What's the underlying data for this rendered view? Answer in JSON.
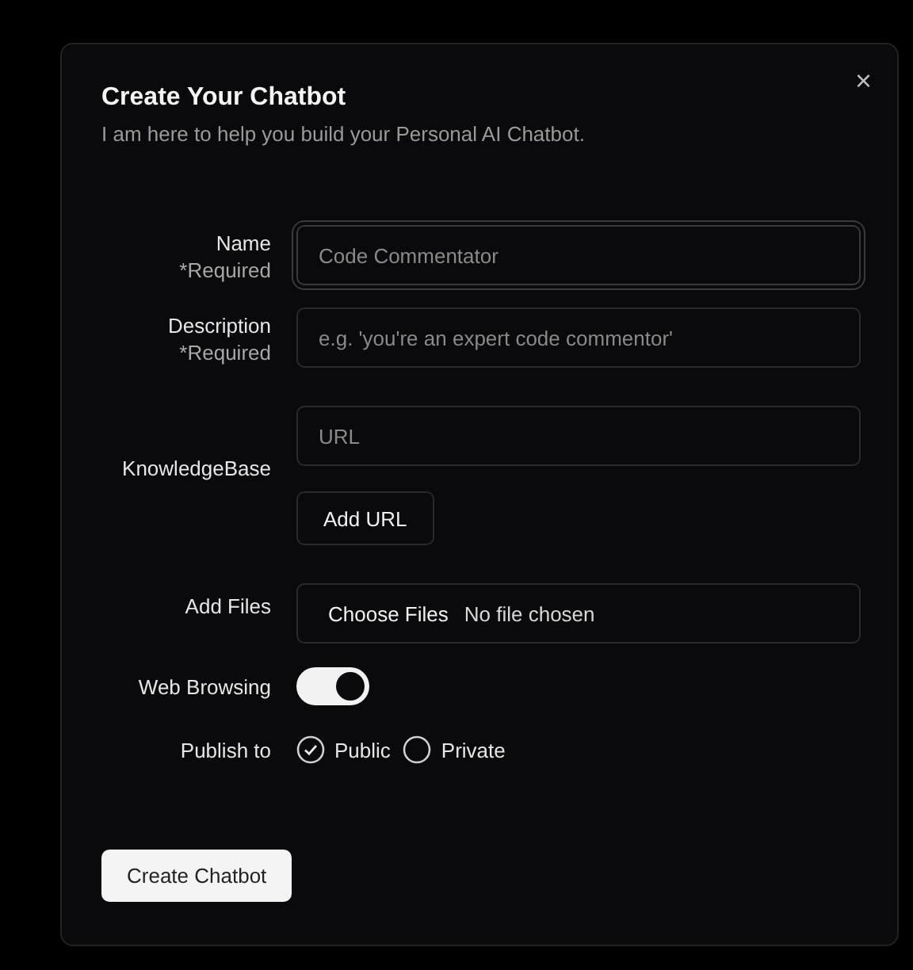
{
  "dialog": {
    "title": "Create Your Chatbot",
    "subtitle": "I am here to help you build your Personal AI Chatbot.",
    "close": "×"
  },
  "name": {
    "label": "Name",
    "required": "*Required",
    "placeholder": "Code Commentator",
    "focused": true
  },
  "description": {
    "label": "Description",
    "required": "*Required",
    "placeholder": "e.g. 'you're an expert code commentor'",
    "focused": false
  },
  "knowledge_base": {
    "label": "KnowledgeBase",
    "placeholder": "URL",
    "button": "Add URL"
  },
  "add_files": {
    "label": "Add Files",
    "button": "Choose Files",
    "status": "No file chosen"
  },
  "web_browsing": {
    "label": "Web Browsing",
    "on": true
  },
  "publish_to": {
    "label": "Publish to",
    "options": [
      {
        "label": "Public",
        "selected": true
      },
      {
        "label": "Private",
        "selected": false
      }
    ]
  },
  "submit": "Create Chatbot"
}
